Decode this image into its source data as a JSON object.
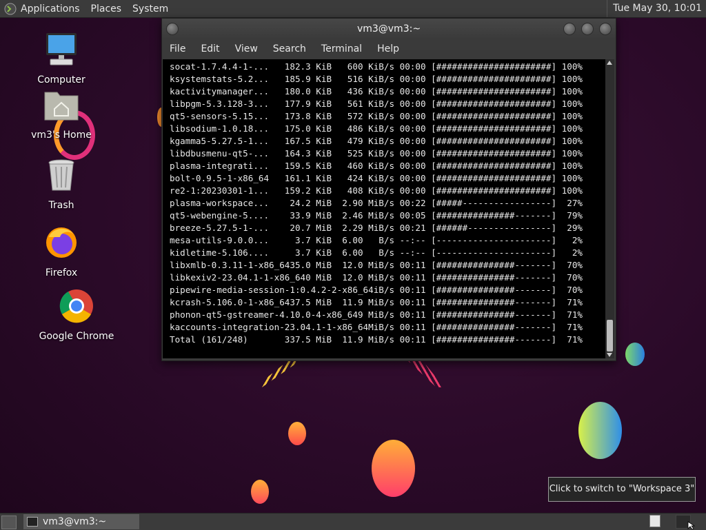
{
  "top_panel": {
    "menus": [
      "Applications",
      "Places",
      "System"
    ],
    "clock": "Tue May 30, 10:01"
  },
  "desktop_icons": [
    {
      "label": "Computer"
    },
    {
      "label": "vm3's Home"
    },
    {
      "label": "Trash"
    },
    {
      "label": "Firefox"
    },
    {
      "label": "Google Chrome"
    }
  ],
  "terminal": {
    "title": "vm3@vm3:~",
    "menu": [
      "File",
      "Edit",
      "View",
      "Search",
      "Terminal",
      "Help"
    ],
    "lines": [
      "socat-1.7.4.4-1-...   182.3 KiB   600 KiB/s 00:00 [######################] 100%",
      "ksystemstats-5.2...   185.9 KiB   516 KiB/s 00:00 [######################] 100%",
      "kactivitymanager...   180.0 KiB   436 KiB/s 00:00 [######################] 100%",
      "libpgm-5.3.128-3...   177.9 KiB   561 KiB/s 00:00 [######################] 100%",
      "qt5-sensors-5.15...   173.8 KiB   572 KiB/s 00:00 [######################] 100%",
      "libsodium-1.0.18...   175.0 KiB   486 KiB/s 00:00 [######################] 100%",
      "kgamma5-5.27.5-1...   167.5 KiB   479 KiB/s 00:00 [######################] 100%",
      "libdbusmenu-qt5-...   164.3 KiB   525 KiB/s 00:00 [######################] 100%",
      "plasma-integrati...   159.5 KiB   460 KiB/s 00:00 [######################] 100%",
      "bolt-0.9.5-1-x86_64   161.1 KiB   424 KiB/s 00:00 [######################] 100%",
      "re2-1:20230301-1...   159.2 KiB   408 KiB/s 00:00 [######################] 100%",
      "plasma-workspace...    24.2 MiB  2.90 MiB/s 00:22 [#####-----------------]  27%",
      "qt5-webengine-5....    33.9 MiB  2.46 MiB/s 00:05 [###############-------]  79%",
      "breeze-5.27.5-1-...    20.7 MiB  2.29 MiB/s 00:21 [######----------------]  29%",
      "mesa-utils-9.0.0...     3.7 KiB  6.00   B/s --:-- [----------------------]   2%",
      "kidletime-5.106....     3.7 KiB  6.00   B/s --:-- [----------------------]   2%",
      "libxmlb-0.3.11-1-x86_6435.0 MiB  12.0 MiB/s 00:11 [###############-------]  70%",
      "libkexiv2-23.04.1-1-x86_640 MiB  12.0 MiB/s 00:11 [###############-------]  70%",
      "pipewire-media-session-1:0.4.2-2-x86_64iB/s 00:11 [###############-------]  70%",
      "kcrash-5.106.0-1-x86_6437.5 MiB  11.9 MiB/s 00:11 [###############-------]  71%",
      "phonon-qt5-gstreamer-4.10.0-4-x86_649 MiB/s 00:11 [###############-------]  71%",
      "kaccounts-integration-23.04.1-1-x86_64MiB/s 00:11 [###############-------]  71%",
      "Total (161/248)       337.5 MiB  11.9 MiB/s 00:11 [###############-------]  71%"
    ]
  },
  "tooltip": "Click to switch to \"Workspace 3\"",
  "taskbar": {
    "task_label": "vm3@vm3:~"
  }
}
